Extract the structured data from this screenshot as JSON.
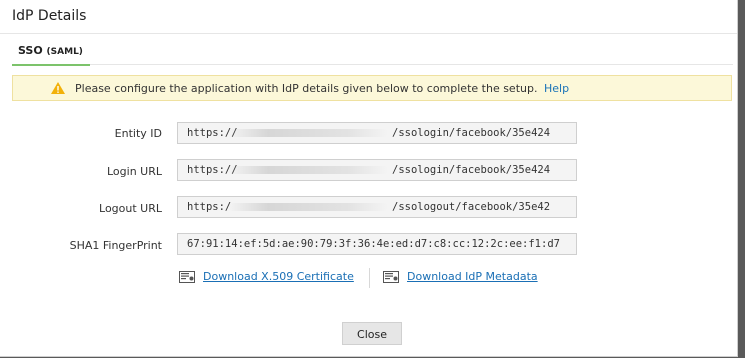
{
  "dialog": {
    "title": "IdP Details",
    "tab": {
      "label": "SSO",
      "sub": "(SAML)"
    },
    "alert": {
      "message": "Please configure the application with IdP details given below to complete the setup.",
      "link": "Help"
    },
    "fields": [
      {
        "label": "Entity ID",
        "prefix": "https://",
        "suffix": "/ssologin/facebook/35e424"
      },
      {
        "label": "Login URL",
        "prefix": "https://",
        "suffix": "/ssologin/facebook/35e424"
      },
      {
        "label": "Logout URL",
        "prefix": "https:/",
        "suffix": "/ssologout/facebook/35e42"
      },
      {
        "label": "SHA1 FingerPrint",
        "value": "67:91:14:ef:5d:ae:90:79:3f:36:4e:ed:d7:c8:cc:12:2c:ee:f1:d7"
      }
    ],
    "downloads": {
      "certificate": "Download X.509 Certificate",
      "metadata": "Download IdP Metadata"
    },
    "close_label": "Close"
  }
}
